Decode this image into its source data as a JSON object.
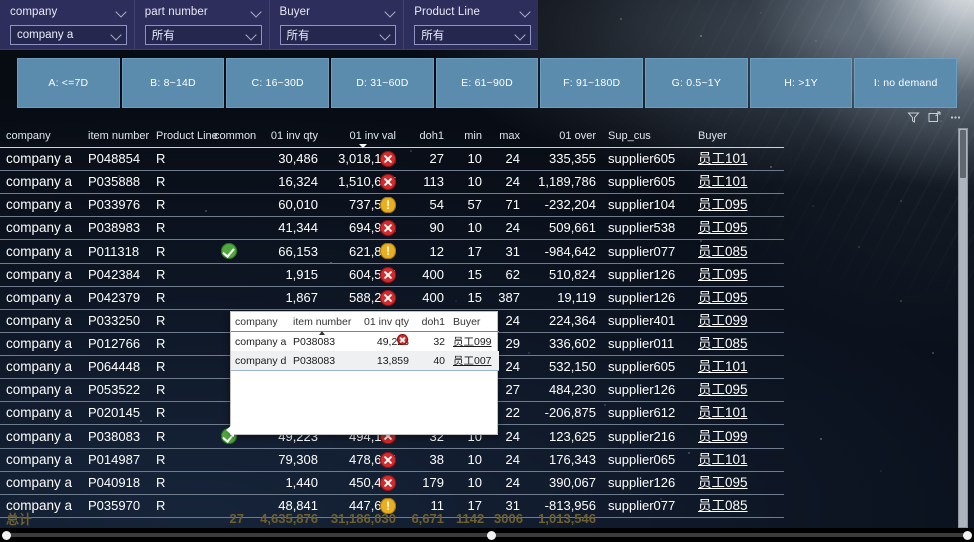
{
  "slicers": [
    {
      "caption": "company",
      "value": "company a",
      "icon": "chevron-down-icon"
    },
    {
      "caption": "part number",
      "value": "所有",
      "icon": "chevron-down-icon"
    },
    {
      "caption": "Buyer",
      "value": "所有",
      "icon": "chevron-down-icon"
    },
    {
      "caption": "Product Line",
      "value": "所有",
      "icon": "chevron-down-icon"
    }
  ],
  "buckets": [
    {
      "label": "A: <=7D"
    },
    {
      "label": "B: 8~14D"
    },
    {
      "label": "C: 16~30D"
    },
    {
      "label": "D: 31~60D"
    },
    {
      "label": "E: 61~90D"
    },
    {
      "label": "F: 91~180D"
    },
    {
      "label": "G: 0.5~1Y"
    },
    {
      "label": "H: >1Y"
    },
    {
      "label": "I: no demand"
    }
  ],
  "visual_header": {
    "icons": [
      "filter-icon",
      "focus-mode-icon",
      "more-options-icon"
    ]
  },
  "table": {
    "columns": [
      {
        "key": "company",
        "label": "company",
        "align": "left"
      },
      {
        "key": "item_number",
        "label": "item number",
        "align": "left"
      },
      {
        "key": "product_line",
        "label": "Product Line",
        "align": "left"
      },
      {
        "key": "common",
        "label": "common",
        "align": "center"
      },
      {
        "key": "inv_qty",
        "label": "01 inv qty",
        "align": "right"
      },
      {
        "key": "inv_val",
        "label": "01 inv val",
        "align": "right",
        "sorted": "desc"
      },
      {
        "key": "doh1",
        "label": "doh1",
        "align": "right"
      },
      {
        "key": "min",
        "label": "min",
        "align": "right"
      },
      {
        "key": "max",
        "label": "max",
        "align": "right"
      },
      {
        "key": "over",
        "label": "01 over",
        "align": "right"
      },
      {
        "key": "sup_cus",
        "label": "Sup_cus",
        "align": "left"
      },
      {
        "key": "buyer",
        "label": "Buyer",
        "align": "left"
      }
    ],
    "rows": [
      {
        "company": "company a",
        "item_number": "P048854",
        "product_line": "R",
        "common": "",
        "inv_qty": "30,486",
        "inv_val": "3,018,191",
        "status": "red",
        "doh1": "27",
        "min": "10",
        "max": "24",
        "over": "335,355",
        "sup_cus": "supplier605",
        "buyer": "员工101"
      },
      {
        "company": "company a",
        "item_number": "P035888",
        "product_line": "R",
        "common": "",
        "inv_qty": "16,324",
        "inv_val": "1,510,627",
        "status": "red",
        "doh1": "113",
        "min": "10",
        "max": "24",
        "over": "1,189,786",
        "sup_cus": "supplier605",
        "buyer": "员工101"
      },
      {
        "company": "company a",
        "item_number": "P033976",
        "product_line": "R",
        "common": "",
        "inv_qty": "60,010",
        "inv_val": "737,590",
        "status": "amber",
        "doh1": "54",
        "min": "57",
        "max": "71",
        "over": "-232,204",
        "sup_cus": "supplier104",
        "buyer": "员工095"
      },
      {
        "company": "company a",
        "item_number": "P038983",
        "product_line": "R",
        "common": "",
        "inv_qty": "41,344",
        "inv_val": "694,992",
        "status": "red",
        "doh1": "90",
        "min": "10",
        "max": "24",
        "over": "509,661",
        "sup_cus": "supplier538",
        "buyer": "员工095"
      },
      {
        "company": "company a",
        "item_number": "P011318",
        "product_line": "R",
        "common": "green",
        "inv_qty": "66,153",
        "inv_val": "621,879",
        "status": "amber",
        "doh1": "12",
        "min": "17",
        "max": "31",
        "over": "-984,642",
        "sup_cus": "supplier077",
        "buyer": "员工085"
      },
      {
        "company": "company a",
        "item_number": "P042384",
        "product_line": "R",
        "common": "",
        "inv_qty": "1,915",
        "inv_val": "604,525",
        "status": "red",
        "doh1": "400",
        "min": "15",
        "max": "62",
        "over": "510,824",
        "sup_cus": "supplier126",
        "buyer": "员工095"
      },
      {
        "company": "company a",
        "item_number": "P042379",
        "product_line": "R",
        "common": "",
        "inv_qty": "1,867",
        "inv_val": "588,266",
        "status": "red",
        "doh1": "400",
        "min": "15",
        "max": "387",
        "over": "19,119",
        "sup_cus": "supplier126",
        "buyer": "员工095"
      },
      {
        "company": "company a",
        "item_number": "P033250",
        "product_line": "R",
        "common": "",
        "inv_qty": "",
        "inv_val": "",
        "status": "",
        "doh1": "",
        "min": "",
        "max": "24",
        "over": "224,364",
        "sup_cus": "supplier401",
        "buyer": "员工099"
      },
      {
        "company": "company a",
        "item_number": "P012766",
        "product_line": "R",
        "common": "",
        "inv_qty": "",
        "inv_val": "",
        "status": "",
        "doh1": "",
        "min": "",
        "max": "29",
        "over": "336,602",
        "sup_cus": "supplier011",
        "buyer": "员工085"
      },
      {
        "company": "company a",
        "item_number": "P064448",
        "product_line": "R",
        "common": "",
        "inv_qty": "",
        "inv_val": "",
        "status": "",
        "doh1": "",
        "min": "",
        "max": "24",
        "over": "532,150",
        "sup_cus": "supplier605",
        "buyer": "员工101"
      },
      {
        "company": "company a",
        "item_number": "P053522",
        "product_line": "R",
        "common": "",
        "inv_qty": "",
        "inv_val": "",
        "status": "",
        "doh1": "",
        "min": "",
        "max": "27",
        "over": "484,230",
        "sup_cus": "supplier126",
        "buyer": "员工095"
      },
      {
        "company": "company a",
        "item_number": "P020145",
        "product_line": "R",
        "common": "",
        "inv_qty": "",
        "inv_val": "",
        "status": "",
        "doh1": "",
        "min": "",
        "max": "22",
        "over": "-206,875",
        "sup_cus": "supplier612",
        "buyer": "员工101"
      },
      {
        "company": "company a",
        "item_number": "P038083",
        "product_line": "R",
        "common": "green",
        "inv_qty": "49,223",
        "inv_val": "494,198",
        "status": "red",
        "doh1": "32",
        "min": "10",
        "max": "24",
        "over": "123,625",
        "sup_cus": "supplier216",
        "buyer": "员工099"
      },
      {
        "company": "company a",
        "item_number": "P014987",
        "product_line": "R",
        "common": "",
        "inv_qty": "79,308",
        "inv_val": "478,645",
        "status": "red",
        "doh1": "38",
        "min": "10",
        "max": "24",
        "over": "176,343",
        "sup_cus": "supplier065",
        "buyer": "员工101"
      },
      {
        "company": "company a",
        "item_number": "P040918",
        "product_line": "R",
        "common": "",
        "inv_qty": "1,440",
        "inv_val": "450,464",
        "status": "red",
        "doh1": "179",
        "min": "10",
        "max": "24",
        "over": "390,067",
        "sup_cus": "supplier126",
        "buyer": "员工095"
      },
      {
        "company": "company a",
        "item_number": "P035970",
        "product_line": "R",
        "common": "",
        "inv_qty": "48,841",
        "inv_val": "447,676",
        "status": "amber",
        "doh1": "11",
        "min": "17",
        "max": "31",
        "over": "-813,956",
        "sup_cus": "supplier077",
        "buyer": "员工085"
      }
    ],
    "total": {
      "label": "总计",
      "inv_qty": "4,635,876",
      "inv_val": "31,186,030",
      "doh1": "6,671",
      "min": "1142",
      "max": "3006",
      "over": "1,013,546",
      "common_count": "27"
    }
  },
  "popup": {
    "columns": [
      {
        "label": "company",
        "align": "left"
      },
      {
        "label": "item number",
        "align": "left",
        "sorted": "asc"
      },
      {
        "label": "01 inv qty",
        "align": "right"
      },
      {
        "label": "doh1",
        "align": "right"
      },
      {
        "label": "Buyer",
        "align": "left"
      }
    ],
    "rows": [
      {
        "company": "company a",
        "item_number": "P038083",
        "inv_qty": "49,223",
        "status": "red",
        "doh1": "32",
        "buyer": "员工099"
      },
      {
        "company": "company d",
        "item_number": "P038083",
        "inv_qty": "13,859",
        "status": "",
        "doh1": "40",
        "buyer": "员工007"
      }
    ]
  },
  "colors": {
    "slicer_bg": "#2d2e5c",
    "bucket_bg": "#5b8bad",
    "status_red": "#d42b2b",
    "status_amber": "#e8b020",
    "status_green": "#4fa93f",
    "total_text": "#6f6030"
  }
}
